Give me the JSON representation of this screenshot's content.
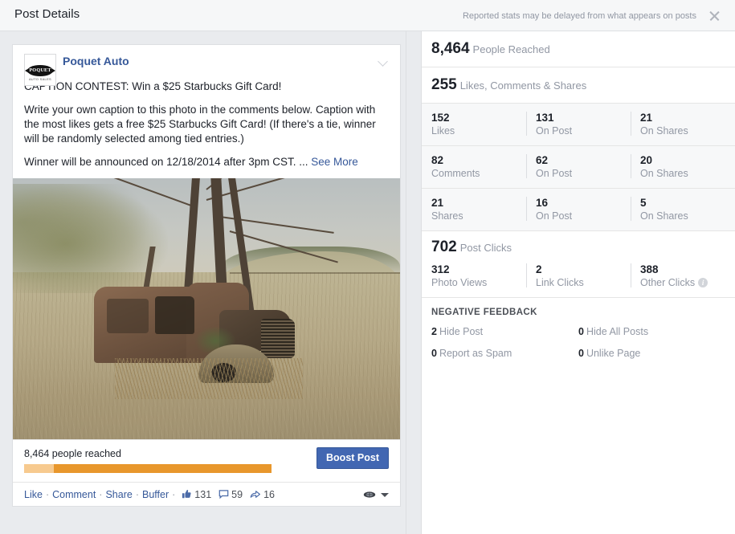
{
  "header": {
    "title": "Post Details",
    "note": "Reported stats may be delayed from what appears on posts",
    "close_icon": "close-icon"
  },
  "post": {
    "page_name": "Poquet Auto",
    "avatar_text": "POQUET",
    "avatar_subtext": "AUTO SALES",
    "chevron_icon": "chevron-down-icon",
    "paragraphs": [
      "CAPTION CONTEST: Win a $25 Starbucks Gift Card!",
      "Write your own caption to this photo in the comments below. Caption with the most likes gets a free $25 Starbucks Gift Card! (If there's a tie, winner will be randomly selected among tied entries.)"
    ],
    "last_line": "Winner will be announced on 12/18/2014 after 3pm CST. ... ",
    "see_more": "See More",
    "photo_alt": "abandoned rusty truck in a field beneath bare trees",
    "reach_text": "8,464 people reached",
    "boost_label": "Boost Post",
    "progress_percent": 88,
    "actions": {
      "like": "Like",
      "comment": "Comment",
      "share": "Share",
      "buffer": "Buffer",
      "separator": "·",
      "like_count": "131",
      "comment_count": "59",
      "share_count": "16",
      "thumb_icon": "thumbs-up-icon",
      "comment_icon": "comment-bubble-icon",
      "share_icon": "share-arrow-icon",
      "audience_icon": "audience-globe-icon",
      "caret_icon": "caret-down-icon"
    }
  },
  "stats": {
    "reach": {
      "value": "8,464",
      "label": "People Reached"
    },
    "engagement": {
      "value": "255",
      "label": "Likes, Comments & Shares"
    },
    "rows": [
      {
        "total": {
          "value": "152",
          "label": "Likes"
        },
        "on_post": {
          "value": "131",
          "label": "On Post"
        },
        "on_shares": {
          "value": "21",
          "label": "On Shares"
        }
      },
      {
        "total": {
          "value": "82",
          "label": "Comments"
        },
        "on_post": {
          "value": "62",
          "label": "On Post"
        },
        "on_shares": {
          "value": "20",
          "label": "On Shares"
        }
      },
      {
        "total": {
          "value": "21",
          "label": "Shares"
        },
        "on_post": {
          "value": "16",
          "label": "On Post"
        },
        "on_shares": {
          "value": "5",
          "label": "On Shares"
        }
      }
    ],
    "clicks": {
      "value": "702",
      "label": "Post Clicks",
      "photo_views": {
        "value": "312",
        "label": "Photo Views"
      },
      "link_clicks": {
        "value": "2",
        "label": "Link Clicks"
      },
      "other_clicks": {
        "value": "388",
        "label": "Other Clicks",
        "info_icon": "info-icon"
      }
    },
    "negative_feedback": {
      "title": "NEGATIVE FEEDBACK",
      "items": [
        {
          "value": "2",
          "label": "Hide Post"
        },
        {
          "value": "0",
          "label": "Hide All Posts"
        },
        {
          "value": "0",
          "label": "Report as Spam"
        },
        {
          "value": "0",
          "label": "Unlike Page"
        }
      ]
    }
  },
  "colors": {
    "brand_blue": "#4267b2",
    "link_blue": "#365899",
    "progress_orange": "#e8972c",
    "progress_light": "#f7ca8f",
    "page_bg": "#e9ebee"
  }
}
